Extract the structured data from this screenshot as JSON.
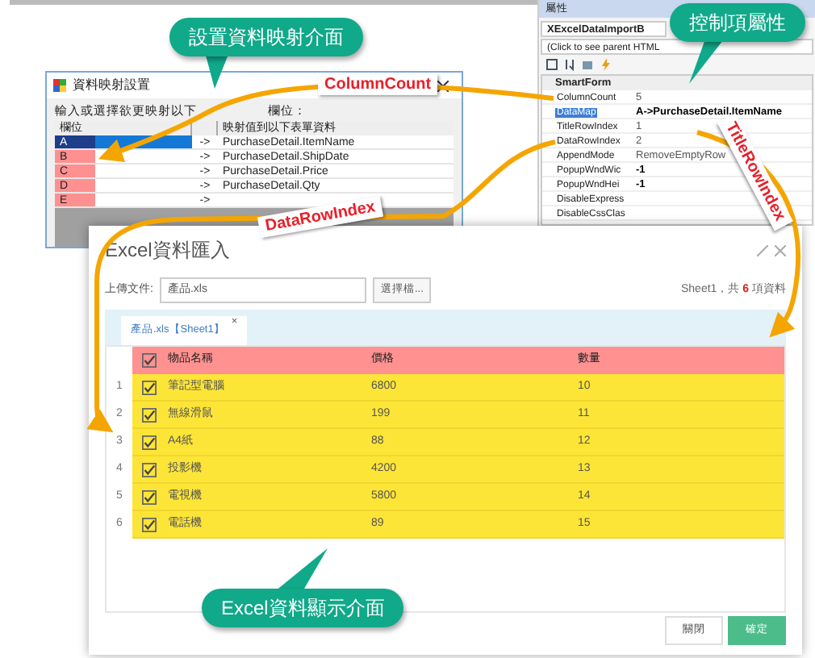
{
  "mapping_dialog": {
    "title": "資料映射設置",
    "instruction_before": "輸入或選擇欲更映射以下",
    "instruction_after": "欄位：",
    "columns": [
      "欄位",
      "映射值到以下表單資料"
    ],
    "rows": [
      {
        "field": "A",
        "arrow": "->",
        "value": "PurchaseDetail.ItemName",
        "selected": true
      },
      {
        "field": "B",
        "arrow": "->",
        "value": "PurchaseDetail.ShipDate",
        "selected": false
      },
      {
        "field": "C",
        "arrow": "->",
        "value": "PurchaseDetail.Price",
        "selected": false
      },
      {
        "field": "D",
        "arrow": "->",
        "value": "PurchaseDetail.Qty",
        "selected": false
      },
      {
        "field": "E",
        "arrow": "->",
        "value": "",
        "selected": false
      }
    ]
  },
  "properties": {
    "title": "屬性",
    "object": "XExcelDataImportB",
    "hint": "(Click to see parent HTML",
    "category": "SmartForm",
    "rows": [
      {
        "name": "ColumnCount",
        "value": "5",
        "selected": false,
        "bold": false
      },
      {
        "name": "DataMap",
        "value": "A->PurchaseDetail.ItemName",
        "selected": true,
        "bold": true
      },
      {
        "name": "TitleRowIndex",
        "value": "1",
        "selected": false,
        "bold": false
      },
      {
        "name": "DataRowIndex",
        "value": "2",
        "selected": false,
        "bold": false
      },
      {
        "name": "AppendMode",
        "value": "RemoveEmptyRow",
        "selected": false,
        "bold": false
      },
      {
        "name": "PopupWndWic",
        "value": "-1",
        "selected": false,
        "bold": true
      },
      {
        "name": "PopupWndHei",
        "value": "-1",
        "selected": false,
        "bold": true
      },
      {
        "name": "DisableExpress",
        "selected": false
      },
      {
        "name": "DisableCssClas",
        "selected": false
      }
    ]
  },
  "import_dialog": {
    "title": "Excel資料匯入",
    "upload_label": "上傳文件:",
    "file": "產品.xls",
    "browse": "選擇檔...",
    "summary_pre": "Sheet1，共",
    "count": "6",
    "summary_post": "項資料",
    "tab": "產品.xls【Sheet1】",
    "tab_close": "×",
    "columns": [
      "物品名稱",
      "價格",
      "數量"
    ],
    "rows": [
      {
        "index": "1",
        "checked": true,
        "name": "筆記型電腦",
        "price": "6800",
        "qty": "10"
      },
      {
        "index": "2",
        "checked": true,
        "name": "無線滑鼠",
        "price": "199",
        "qty": "11"
      },
      {
        "index": "3",
        "checked": true,
        "name": "A4紙",
        "price": "88",
        "qty": "12"
      },
      {
        "index": "4",
        "checked": true,
        "name": "投影機",
        "price": "4200",
        "qty": "13"
      },
      {
        "index": "5",
        "checked": true,
        "name": "電視機",
        "price": "5800",
        "qty": "14"
      },
      {
        "index": "6",
        "checked": true,
        "name": "電話機",
        "price": "89",
        "qty": "15"
      }
    ],
    "header_checked": true,
    "buttons": [
      {
        "label": "關閉",
        "kind": "secondary"
      },
      {
        "label": "確定",
        "kind": "primary"
      }
    ]
  },
  "callouts": [
    {
      "text": "設置資料映射介面"
    },
    {
      "text": "控制項屬性"
    },
    {
      "text": "Excel資料顯示介面"
    }
  ],
  "tags": [
    {
      "text": "ColumnCount"
    },
    {
      "text": "TitleRowIndex"
    },
    {
      "text": "DataRowIndex"
    }
  ]
}
